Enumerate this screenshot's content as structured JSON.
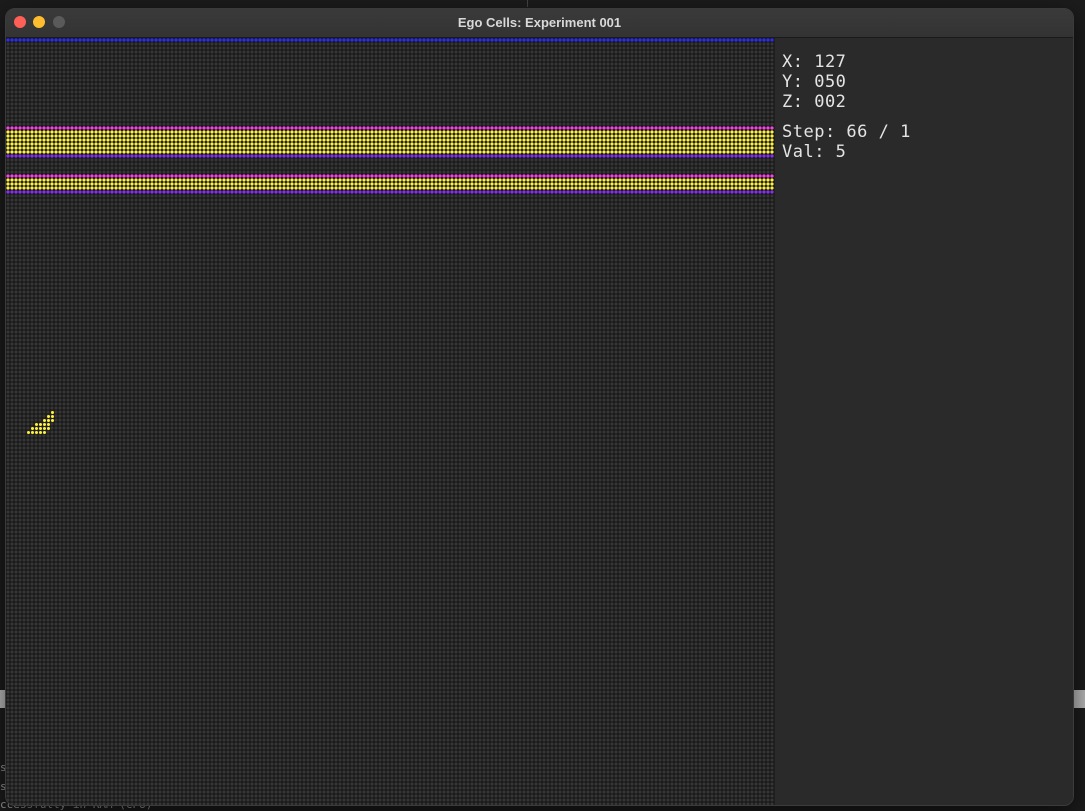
{
  "window": {
    "title": "Ego Cells: Experiment 001"
  },
  "panel": {
    "x_line": "X: 127",
    "y_line": "Y: 050",
    "z_line": "Z: 002",
    "step_line": "Step: 66 / 1",
    "val_line": "Val: 5"
  },
  "background_terminal": {
    "line_1": "s",
    "line_2": "s",
    "line_3": "ccessfully in RAM (CPU)"
  },
  "colors": {
    "alive_yellow": "#fff23a",
    "magenta": "#ff3ef0",
    "purple": "#8a2cff",
    "blue": "#2b2bff",
    "dead_cell": "#363636",
    "close_button": "#fe5f57",
    "minimize_button": "#febc2e"
  }
}
